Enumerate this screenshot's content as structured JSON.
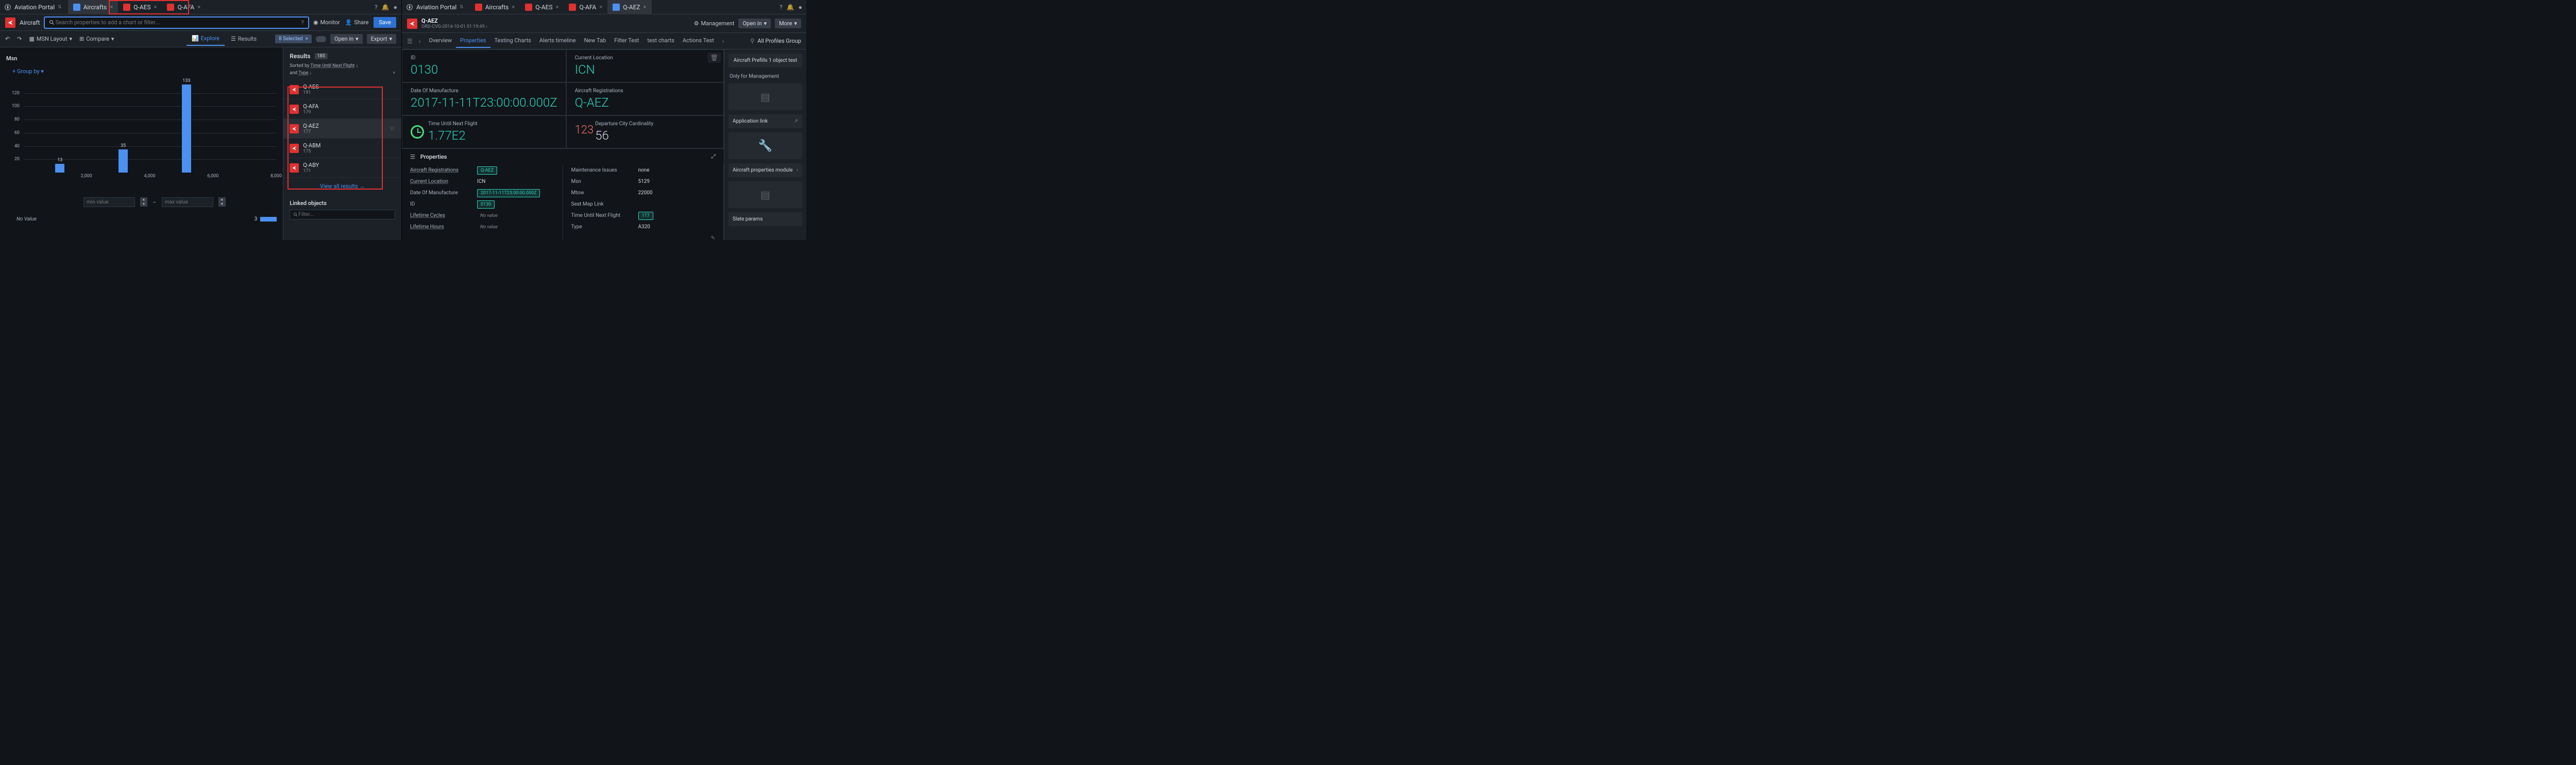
{
  "left": {
    "portal": "Aviation Portal",
    "tabs": [
      {
        "label": "Aircrafts",
        "color": "blue",
        "active": true
      },
      {
        "label": "Q-AES",
        "color": "red"
      },
      {
        "label": "Q-AFA",
        "color": "red"
      }
    ],
    "subbar": {
      "aircraft_label": "Aircraft",
      "search_placeholder": "Search properties to add a chart or filter...",
      "monitor": "Monitor",
      "share": "Share",
      "save": "Save"
    },
    "toolbar": {
      "layout": "MSN Layout",
      "compare": "Compare",
      "explore": "Explore",
      "results": "Results",
      "selected": "8 Selected",
      "open_in": "Open in",
      "export": "Export"
    },
    "chart_panel": {
      "title": "Msn",
      "group_by": "+ Group by",
      "min_placeholder": "min value",
      "max_placeholder": "max value",
      "no_value": "No Value",
      "no_value_count": "3"
    },
    "results_panel": {
      "title": "Results",
      "count": "185",
      "sorted_prefix": "Sorted by ",
      "sort1": "Time Until Next Flight",
      "sort_and": "and ",
      "sort2": "Type",
      "items": [
        {
          "name": "Q-AES",
          "val": "191"
        },
        {
          "name": "Q-AFA",
          "val": "179"
        },
        {
          "name": "Q-AEZ",
          "val": "177",
          "selected": true,
          "star": true
        },
        {
          "name": "Q-ABM",
          "val": "175"
        },
        {
          "name": "Q-ABY",
          "val": "171"
        }
      ],
      "view_all": "View all results",
      "linked": "Linked objects",
      "filter_placeholder": "Filter..."
    }
  },
  "right": {
    "portal": "Aviation Portal",
    "tabs": [
      {
        "label": "Aircrafts",
        "color": "red"
      },
      {
        "label": "Q-AES",
        "color": "red"
      },
      {
        "label": "Q-AFA",
        "color": "red"
      },
      {
        "label": "Q-AEZ",
        "color": "blue",
        "active": true
      }
    ],
    "subbar": {
      "title": "Q-AEZ",
      "subtitle": "ORD-CVG-2014-10-01 01:19:49",
      "management": "Management",
      "open_in": "Open in",
      "more": "More"
    },
    "nav_tabs": [
      "Overview",
      "Properties",
      "Testing Charts",
      "Alerts timeline",
      "New Tab",
      "Filter Test",
      "test charts",
      "Actions Test"
    ],
    "nav_right": "All Profiles Group",
    "stats": [
      {
        "label": "ID",
        "value": "0130"
      },
      {
        "label": "Current Location",
        "value": "ICN"
      },
      {
        "label": "Date Of Manufacture",
        "value": "2017-11-11T23:00:00.000Z"
      },
      {
        "label": "Aircraft Registrations",
        "value": "Q-AEZ"
      },
      {
        "label": "Time Until Next Flight",
        "value": "1.77E2",
        "clock": true
      },
      {
        "label": "Departure City Cardinality",
        "value": "56",
        "red_prefix": "123"
      }
    ],
    "props_head": "Properties",
    "props_left": [
      {
        "label": "Aircraft Registrations",
        "value": "Q-AEZ",
        "chip": true,
        "u": true
      },
      {
        "label": "Current Location",
        "value": "ICN",
        "u": true
      },
      {
        "label": "Date Of Manufacture",
        "value": "2017-11-11T23:00:00.000Z",
        "chip": true
      },
      {
        "label": "ID",
        "value": "0130",
        "chip": true
      },
      {
        "label": "Lifetime Cycles",
        "value": "No value",
        "none": true,
        "u": true
      },
      {
        "label": "Lifetime Hours",
        "value": "No value",
        "none": true,
        "u": true
      }
    ],
    "props_right": [
      {
        "label": "Maintenance Issues",
        "value": "none"
      },
      {
        "label": "Msn",
        "value": "5129"
      },
      {
        "label": "Mtow",
        "value": "22000"
      },
      {
        "label": "Seat Map Link",
        "value": ""
      },
      {
        "label": "Time Until Next Flight",
        "value": "177",
        "chip": true
      },
      {
        "label": "Type",
        "value": "A320"
      }
    ],
    "sidebar": {
      "prefills": "Aircraft Prefills 1 object test",
      "mgmt_head": "Only for Management",
      "app_link": "Application link",
      "props_module": "Aircraft properties module",
      "slate": "Slate params"
    }
  },
  "chart_data": {
    "type": "bar",
    "title": "Msn",
    "x": [
      1000,
      3000,
      5000
    ],
    "values": [
      13,
      35,
      133
    ],
    "xlim": [
      0,
      8000
    ],
    "ylim": [
      0,
      140
    ],
    "x_ticks": [
      2000,
      4000,
      6000,
      8000
    ],
    "y_ticks": [
      20,
      40,
      60,
      80,
      100,
      120
    ],
    "xlabel": "",
    "ylabel": ""
  }
}
